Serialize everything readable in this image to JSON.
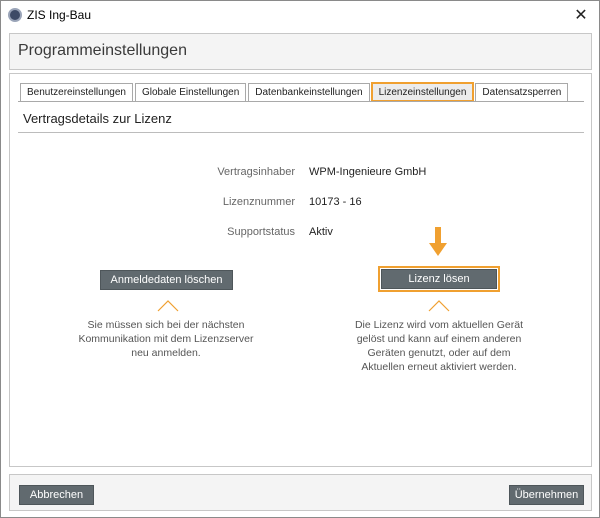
{
  "window": {
    "title": "ZIS Ing-Bau",
    "close_symbol": "✕"
  },
  "header": {
    "title": "Programmeinstellungen"
  },
  "tabs": [
    {
      "label": "Benutzereinstellungen"
    },
    {
      "label": "Globale Einstellungen"
    },
    {
      "label": "Datenbankeinstellungen"
    },
    {
      "label": "Lizenzeinstellungen"
    },
    {
      "label": "Datensatzsperren"
    }
  ],
  "active_tab": "Lizenzeinstellungen",
  "section": {
    "title": "Vertragsdetails zur Lizenz"
  },
  "details": {
    "holder_label": "Vertragsinhaber",
    "holder_value": "WPM-Ingenieure GmbH",
    "license_label": "Lizenznummer",
    "license_value": "10173 - 16",
    "support_label": "Supportstatus",
    "support_value": "Aktiv"
  },
  "actions": {
    "delete_login_label": "Anmeldedaten löschen",
    "delete_login_desc": [
      "Sie müssen sich bei der nächsten",
      "Kommunikation mit dem Lizenzserver",
      "neu anmelden."
    ],
    "release_license_label": "Lizenz lösen",
    "release_license_desc": [
      "Die Lizenz wird vom aktuellen Gerät",
      "gelöst und kann auf einem anderen",
      "Geräten genutzt, oder auf dem",
      "Aktuellen erneut aktiviert werden."
    ]
  },
  "footer": {
    "cancel_label": "Abbrechen",
    "apply_label": "Übernehmen"
  },
  "colors": {
    "accent": "#f0a030",
    "button_bg": "#616a6f"
  }
}
